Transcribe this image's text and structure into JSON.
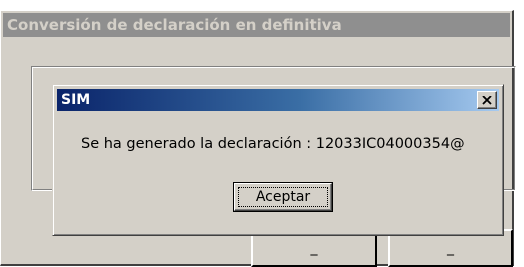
{
  "parent_window": {
    "title": "Conversión de declaración en definitiva",
    "button_1_label": "_ ",
    "button_2_label": "_"
  },
  "dialog": {
    "title": "SIM",
    "close_icon": "close-x-icon",
    "message": "Se ha generado la declaración  : 12033IC04000354@",
    "ok_label": "Aceptar"
  },
  "colors": {
    "face": "#d4d0c8",
    "titlebar_start": "#0a246a",
    "titlebar_end": "#a6caf0",
    "inactive_titlebar": "#8f8f8f"
  }
}
